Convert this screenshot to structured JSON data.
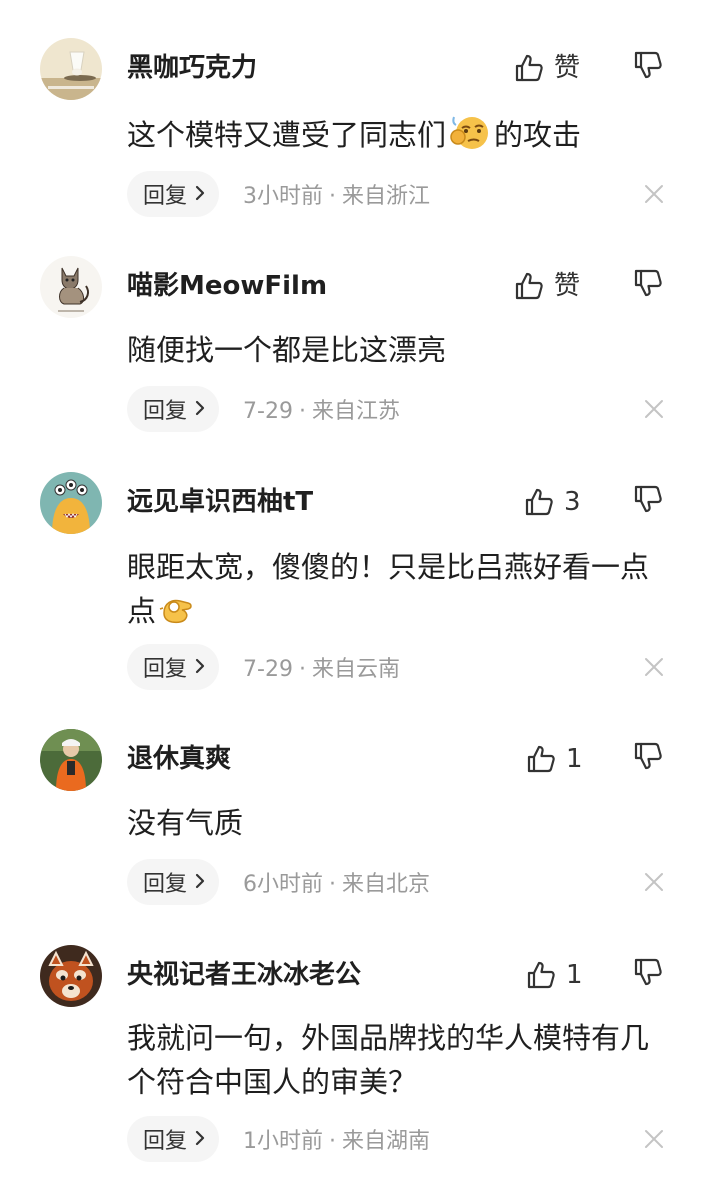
{
  "comments": [
    {
      "username": "黑咖巧克力",
      "like_label": "赞",
      "text_before": "这个模特又遭受了同志们",
      "emoji": "thinking-emoji",
      "text_after": "的攻击",
      "reply_label": "回复",
      "time": "3小时前",
      "separator": "·",
      "location": "来自浙江",
      "avatar": "badminton-shuttlecock-avatar"
    },
    {
      "username": "喵影MeowFilm",
      "like_label": "赞",
      "text": "随便找一个都是比这漂亮",
      "reply_label": "回复",
      "time": "7-29",
      "separator": "·",
      "location": "来自江苏",
      "avatar": "cat-sketch-avatar"
    },
    {
      "username": "远见卓识西柚tT",
      "like_label": "3",
      "text_before": "眼距太宽，傻傻的！只是比吕燕好看一点点",
      "emoji": "ok-hand-emoji",
      "text_after": "",
      "reply_label": "回复",
      "time": "7-29",
      "separator": "·",
      "location": "来自云南",
      "avatar": "cartoon-monster-avatar"
    },
    {
      "username": "退休真爽",
      "like_label": "1",
      "text": "没有气质",
      "reply_label": "回复",
      "time": "6小时前",
      "separator": "·",
      "location": "来自北京",
      "avatar": "person-orange-jacket-avatar"
    },
    {
      "username": "央视记者王冰冰老公",
      "like_label": "1",
      "text": "我就问一句，外国品牌找的华人模特有几个符合中国人的审美？",
      "reply_label": "回复",
      "time": "1小时前",
      "separator": "·",
      "location": "来自湖南",
      "avatar": "red-panda-avatar"
    }
  ],
  "colors": {
    "text": "#1f1f1f",
    "meta": "#9a9a9a",
    "reply_bg": "#f5f5f5",
    "close": "#c4c4c4"
  }
}
